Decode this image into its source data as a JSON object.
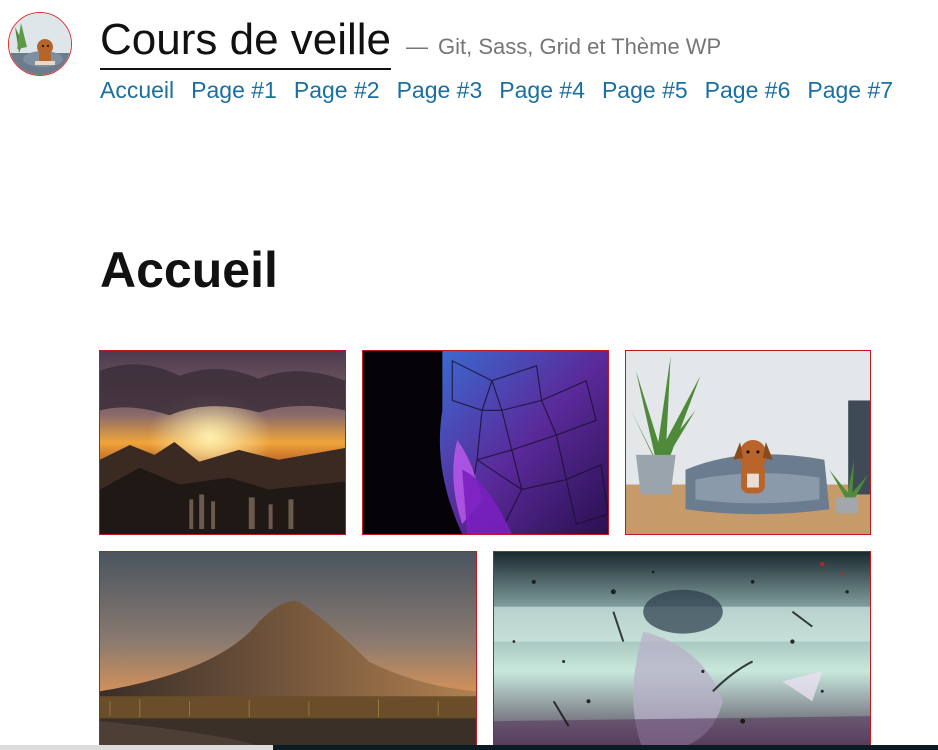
{
  "site": {
    "title": "Cours de veille",
    "tagline_dash": "—",
    "tagline": "Git, Sass, Grid et Thème WP",
    "avatar_icon": "dog-avatar-icon"
  },
  "nav": {
    "items": [
      {
        "label": "Accueil"
      },
      {
        "label": "Page #1"
      },
      {
        "label": "Page #2"
      },
      {
        "label": "Page #3"
      },
      {
        "label": "Page #4"
      },
      {
        "label": "Page #5"
      },
      {
        "label": "Page #6"
      },
      {
        "label": "Page #7"
      }
    ]
  },
  "main": {
    "heading": "Accueil",
    "gallery": [
      {
        "subject": "mountain-sunset-clouds"
      },
      {
        "subject": "purple-geodesic-sphere"
      },
      {
        "subject": "dog-in-bed-with-plants"
      },
      {
        "subject": "volcano-at-dusk"
      },
      {
        "subject": "abstract-paint-splatter"
      }
    ]
  },
  "colors": {
    "link": "#1a6fa1",
    "tile_border": "#c0181f",
    "title": "#111111",
    "tagline": "#767676"
  }
}
